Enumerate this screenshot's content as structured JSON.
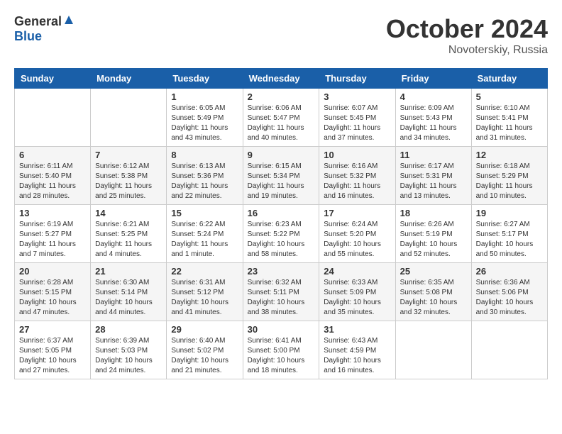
{
  "logo": {
    "general": "General",
    "blue": "Blue"
  },
  "title": "October 2024",
  "location": "Novoterskiy, Russia",
  "days_of_week": [
    "Sunday",
    "Monday",
    "Tuesday",
    "Wednesday",
    "Thursday",
    "Friday",
    "Saturday"
  ],
  "weeks": [
    [
      {
        "day": "",
        "info": ""
      },
      {
        "day": "",
        "info": ""
      },
      {
        "day": "1",
        "info": "Sunrise: 6:05 AM\nSunset: 5:49 PM\nDaylight: 11 hours and 43 minutes."
      },
      {
        "day": "2",
        "info": "Sunrise: 6:06 AM\nSunset: 5:47 PM\nDaylight: 11 hours and 40 minutes."
      },
      {
        "day": "3",
        "info": "Sunrise: 6:07 AM\nSunset: 5:45 PM\nDaylight: 11 hours and 37 minutes."
      },
      {
        "day": "4",
        "info": "Sunrise: 6:09 AM\nSunset: 5:43 PM\nDaylight: 11 hours and 34 minutes."
      },
      {
        "day": "5",
        "info": "Sunrise: 6:10 AM\nSunset: 5:41 PM\nDaylight: 11 hours and 31 minutes."
      }
    ],
    [
      {
        "day": "6",
        "info": "Sunrise: 6:11 AM\nSunset: 5:40 PM\nDaylight: 11 hours and 28 minutes."
      },
      {
        "day": "7",
        "info": "Sunrise: 6:12 AM\nSunset: 5:38 PM\nDaylight: 11 hours and 25 minutes."
      },
      {
        "day": "8",
        "info": "Sunrise: 6:13 AM\nSunset: 5:36 PM\nDaylight: 11 hours and 22 minutes."
      },
      {
        "day": "9",
        "info": "Sunrise: 6:15 AM\nSunset: 5:34 PM\nDaylight: 11 hours and 19 minutes."
      },
      {
        "day": "10",
        "info": "Sunrise: 6:16 AM\nSunset: 5:32 PM\nDaylight: 11 hours and 16 minutes."
      },
      {
        "day": "11",
        "info": "Sunrise: 6:17 AM\nSunset: 5:31 PM\nDaylight: 11 hours and 13 minutes."
      },
      {
        "day": "12",
        "info": "Sunrise: 6:18 AM\nSunset: 5:29 PM\nDaylight: 11 hours and 10 minutes."
      }
    ],
    [
      {
        "day": "13",
        "info": "Sunrise: 6:19 AM\nSunset: 5:27 PM\nDaylight: 11 hours and 7 minutes."
      },
      {
        "day": "14",
        "info": "Sunrise: 6:21 AM\nSunset: 5:25 PM\nDaylight: 11 hours and 4 minutes."
      },
      {
        "day": "15",
        "info": "Sunrise: 6:22 AM\nSunset: 5:24 PM\nDaylight: 11 hours and 1 minute."
      },
      {
        "day": "16",
        "info": "Sunrise: 6:23 AM\nSunset: 5:22 PM\nDaylight: 10 hours and 58 minutes."
      },
      {
        "day": "17",
        "info": "Sunrise: 6:24 AM\nSunset: 5:20 PM\nDaylight: 10 hours and 55 minutes."
      },
      {
        "day": "18",
        "info": "Sunrise: 6:26 AM\nSunset: 5:19 PM\nDaylight: 10 hours and 52 minutes."
      },
      {
        "day": "19",
        "info": "Sunrise: 6:27 AM\nSunset: 5:17 PM\nDaylight: 10 hours and 50 minutes."
      }
    ],
    [
      {
        "day": "20",
        "info": "Sunrise: 6:28 AM\nSunset: 5:15 PM\nDaylight: 10 hours and 47 minutes."
      },
      {
        "day": "21",
        "info": "Sunrise: 6:30 AM\nSunset: 5:14 PM\nDaylight: 10 hours and 44 minutes."
      },
      {
        "day": "22",
        "info": "Sunrise: 6:31 AM\nSunset: 5:12 PM\nDaylight: 10 hours and 41 minutes."
      },
      {
        "day": "23",
        "info": "Sunrise: 6:32 AM\nSunset: 5:11 PM\nDaylight: 10 hours and 38 minutes."
      },
      {
        "day": "24",
        "info": "Sunrise: 6:33 AM\nSunset: 5:09 PM\nDaylight: 10 hours and 35 minutes."
      },
      {
        "day": "25",
        "info": "Sunrise: 6:35 AM\nSunset: 5:08 PM\nDaylight: 10 hours and 32 minutes."
      },
      {
        "day": "26",
        "info": "Sunrise: 6:36 AM\nSunset: 5:06 PM\nDaylight: 10 hours and 30 minutes."
      }
    ],
    [
      {
        "day": "27",
        "info": "Sunrise: 6:37 AM\nSunset: 5:05 PM\nDaylight: 10 hours and 27 minutes."
      },
      {
        "day": "28",
        "info": "Sunrise: 6:39 AM\nSunset: 5:03 PM\nDaylight: 10 hours and 24 minutes."
      },
      {
        "day": "29",
        "info": "Sunrise: 6:40 AM\nSunset: 5:02 PM\nDaylight: 10 hours and 21 minutes."
      },
      {
        "day": "30",
        "info": "Sunrise: 6:41 AM\nSunset: 5:00 PM\nDaylight: 10 hours and 18 minutes."
      },
      {
        "day": "31",
        "info": "Sunrise: 6:43 AM\nSunset: 4:59 PM\nDaylight: 10 hours and 16 minutes."
      },
      {
        "day": "",
        "info": ""
      },
      {
        "day": "",
        "info": ""
      }
    ]
  ]
}
